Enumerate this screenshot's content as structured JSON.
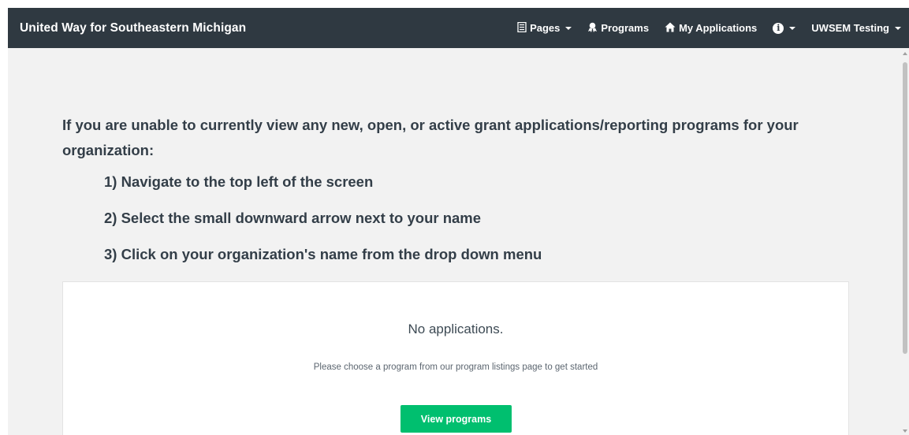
{
  "navbar": {
    "brand": "United Way for Southeastern Michigan",
    "pages_label": "Pages",
    "programs_label": "Programs",
    "my_applications_label": "My Applications",
    "info_glyph": "i",
    "user_label": "UWSEM Testing",
    "bg_color": "#2f3941"
  },
  "instructions": {
    "intro": "If you are unable to currently view any new, open, or active grant applications/reporting programs for your organization:",
    "steps": [
      "1) Navigate to the top left of the screen",
      "2) Select the small downward arrow next to your name",
      "3) Click on your organization's name from the drop down menu"
    ]
  },
  "empty_state": {
    "title": "No applications.",
    "subtitle": "Please choose a program from our program listings page to get started",
    "button_label": "View programs",
    "button_color": "#00bf6f"
  },
  "icons": {
    "pages": "document-icon",
    "programs": "ribbon-award-icon",
    "my_applications": "home-icon",
    "info": "info-icon",
    "caret": "caret-down-icon"
  }
}
